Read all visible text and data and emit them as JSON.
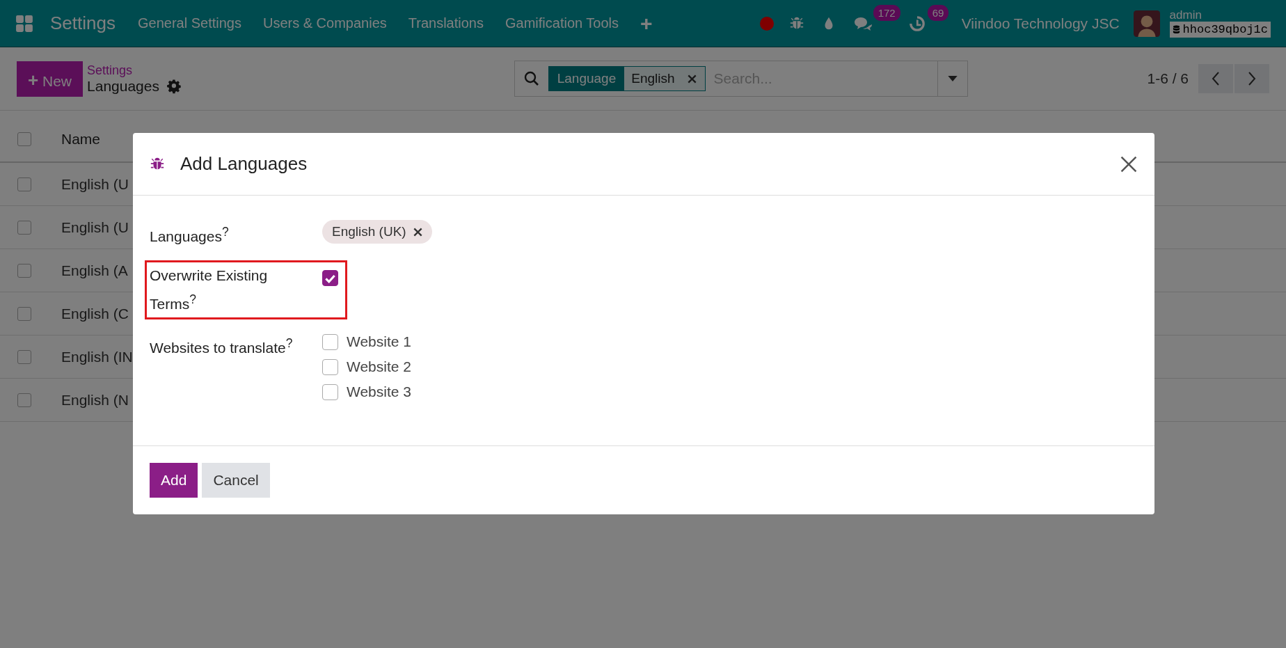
{
  "navbar": {
    "app_name": "Settings",
    "menu": [
      "General Settings",
      "Users & Companies",
      "Translations",
      "Gamification Tools"
    ],
    "add_symbol": "+",
    "messages_count": "172",
    "activities_count": "69",
    "company": "Viindoo Technology JSC",
    "user": "admin",
    "database": "hhoc39qboj1c"
  },
  "control_panel": {
    "new_button": "New",
    "new_symbol": "+",
    "breadcrumb": "Settings",
    "title": "Languages",
    "facet": {
      "label": "Language",
      "value": "English"
    },
    "search_placeholder": "Search...",
    "pager": "1-6 / 6"
  },
  "table": {
    "header_checked": false,
    "column_1": "Name",
    "rows": [
      {
        "name": "English (U",
        "checked": false
      },
      {
        "name": "English (U",
        "checked": false
      },
      {
        "name": "English (A",
        "checked": false
      },
      {
        "name": "English (C",
        "checked": false
      },
      {
        "name": "English (IN",
        "checked": false
      },
      {
        "name": "English (N",
        "checked": false
      }
    ]
  },
  "dialog": {
    "title": "Add Languages",
    "fields": [
      {
        "kind": "tags",
        "label": "Languages$^{?}$",
        "tags": [
          "English (UK)"
        ],
        "highlighted": false
      },
      {
        "kind": "checkbox",
        "label": "Overwrite Existing Terms$^{?}$",
        "checked": true,
        "highlighted": true
      },
      {
        "kind": "checklist",
        "label": "Websites to translate$^{?}$",
        "highlighted": false,
        "options": [
          {
            "label": "Website 1",
            "checked": false
          },
          {
            "label": "Website 2",
            "checked": false
          },
          {
            "label": "Website 3",
            "checked": false
          }
        ]
      }
    ],
    "buttons": [
      {
        "label": "Add",
        "kind": "primary"
      },
      {
        "label": "Cancel",
        "kind": "secondary"
      }
    ]
  }
}
